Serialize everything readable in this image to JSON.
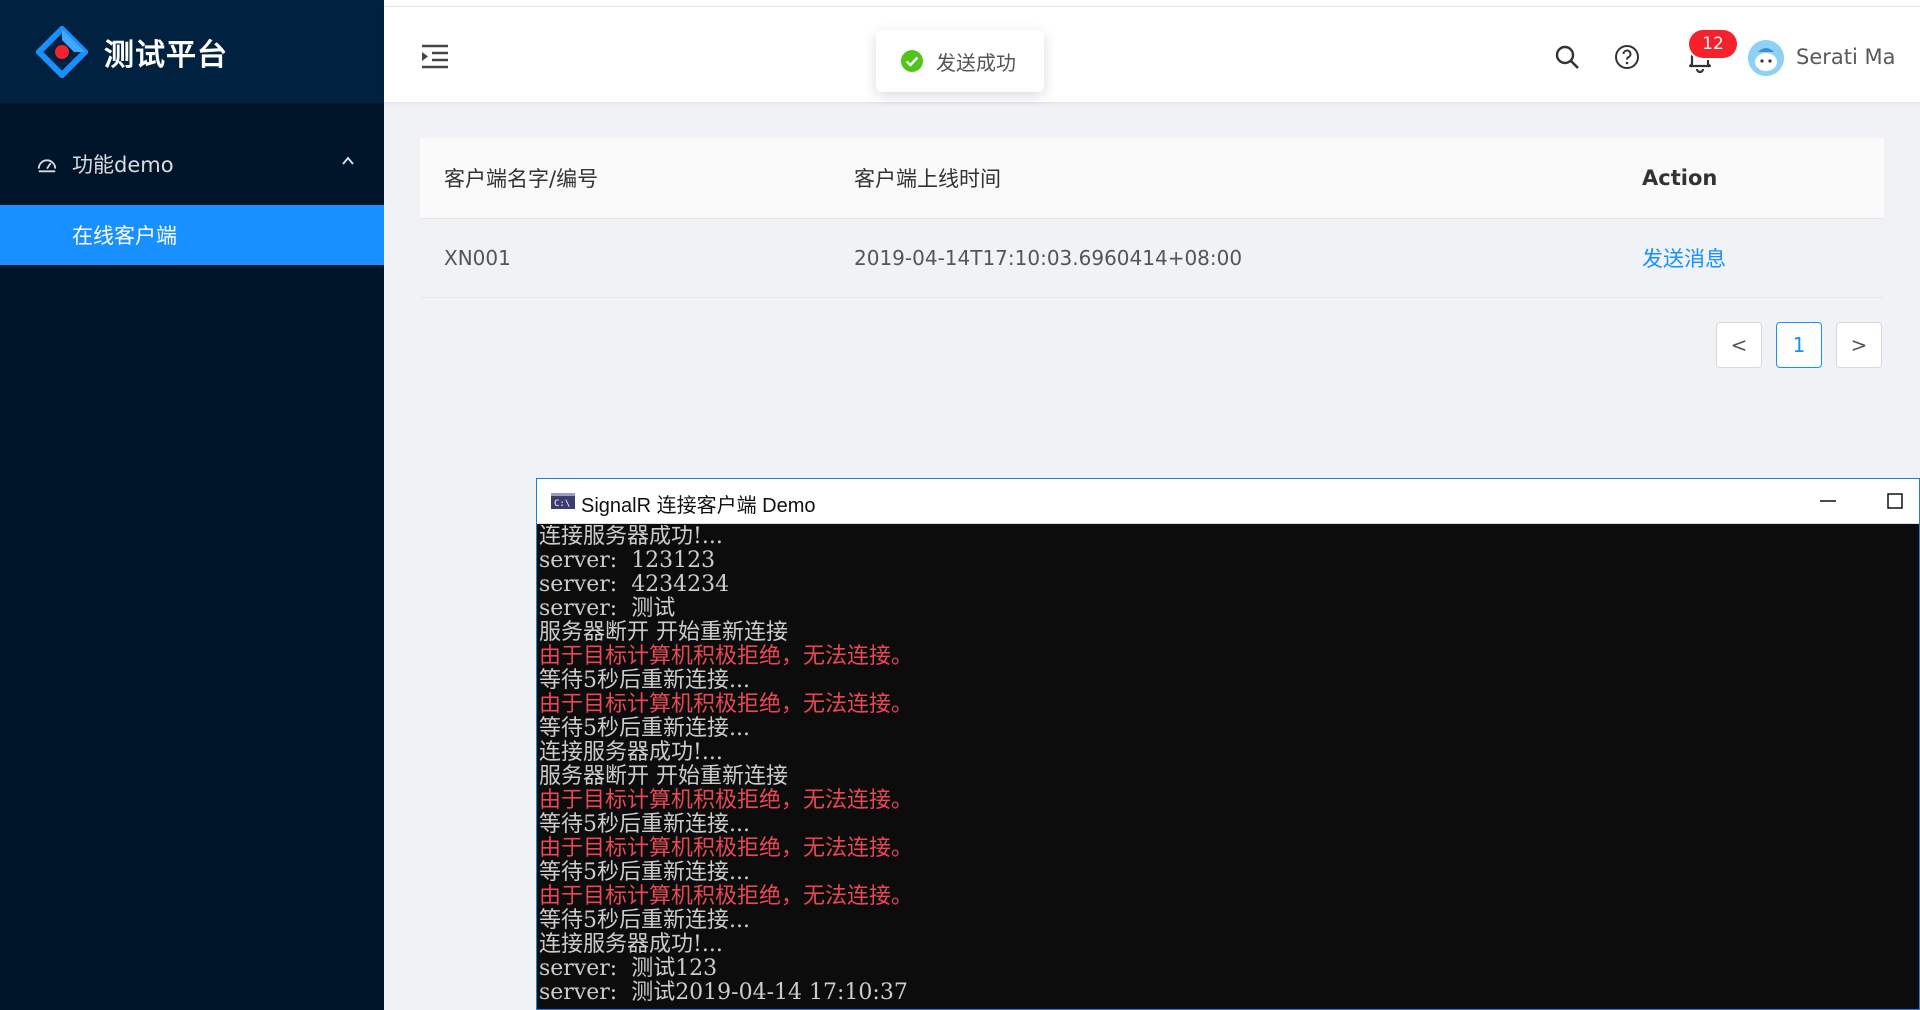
{
  "app": {
    "title": "测试平台",
    "brand_color": "#1890ff",
    "sidebar_bg": "#001529"
  },
  "sidebar": {
    "group": {
      "label": "功能demo",
      "icon": "dashboard-icon",
      "expanded": true
    },
    "items": [
      {
        "label": "在线客户端",
        "selected": true
      }
    ]
  },
  "header": {
    "icons": [
      "menu-fold-icon",
      "search-icon",
      "question-circle-icon",
      "bell-icon"
    ],
    "notification_count": "12",
    "user_name": "Serati Ma"
  },
  "toast": {
    "text": "发送成功",
    "icon": "check-circle-icon"
  },
  "table": {
    "columns": [
      "客户端名字/编号",
      "客户端上线时间",
      "Action"
    ],
    "rows": [
      {
        "name": "XN001",
        "online_time": "2019-04-14T17:10:03.6960414+08:00",
        "action": "发送消息"
      }
    ]
  },
  "pagination": {
    "prev": "<",
    "current": "1",
    "next": ">"
  },
  "console": {
    "title": "SignalR 连接客户端 Demo",
    "lines": [
      {
        "text": "连接服务器成功!...",
        "error": false
      },
      {
        "text": "server:  123123",
        "error": false
      },
      {
        "text": "server:  4234234",
        "error": false
      },
      {
        "text": "server:  测试",
        "error": false
      },
      {
        "text": "服务器断开 开始重新连接",
        "error": false
      },
      {
        "text": "由于目标计算机积极拒绝，无法连接。",
        "error": true
      },
      {
        "text": "等待5秒后重新连接...",
        "error": false
      },
      {
        "text": "由于目标计算机积极拒绝，无法连接。",
        "error": true
      },
      {
        "text": "等待5秒后重新连接...",
        "error": false
      },
      {
        "text": "连接服务器成功!...",
        "error": false
      },
      {
        "text": "服务器断开 开始重新连接",
        "error": false
      },
      {
        "text": "由于目标计算机积极拒绝，无法连接。",
        "error": true
      },
      {
        "text": "等待5秒后重新连接...",
        "error": false
      },
      {
        "text": "由于目标计算机积极拒绝，无法连接。",
        "error": true
      },
      {
        "text": "等待5秒后重新连接...",
        "error": false
      },
      {
        "text": "由于目标计算机积极拒绝，无法连接。",
        "error": true
      },
      {
        "text": "等待5秒后重新连接...",
        "error": false
      },
      {
        "text": "连接服务器成功!...",
        "error": false
      },
      {
        "text": "server:  测试123",
        "error": false
      },
      {
        "text": "server:  测试2019-04-14 17:10:37",
        "error": false
      }
    ]
  }
}
